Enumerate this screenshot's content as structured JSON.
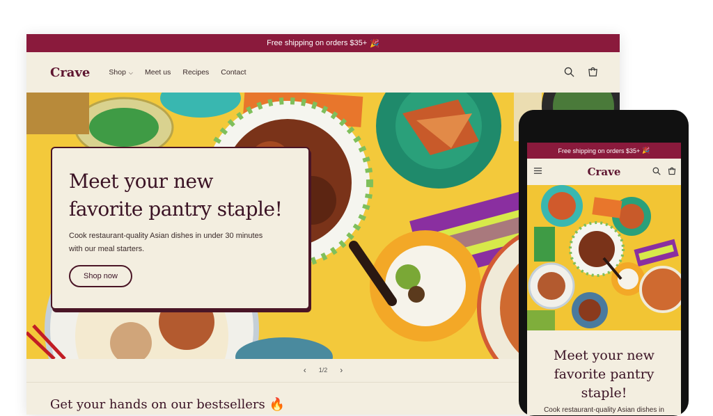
{
  "announcement": {
    "text": "Free shipping on orders $35+",
    "emoji": "🎉"
  },
  "brand": {
    "name": "Crave",
    "color": "#5e1530",
    "accent": "#8a1a3c"
  },
  "nav": {
    "items": [
      {
        "label": "Shop",
        "has_dropdown": true
      },
      {
        "label": "Meet us"
      },
      {
        "label": "Recipes"
      },
      {
        "label": "Contact"
      }
    ]
  },
  "header_icons": [
    "search-icon",
    "cart-icon"
  ],
  "hero": {
    "title_line1": "Meet your new",
    "title_line2": "favorite pantry staple!",
    "subtitle_line1": "Cook restaurant-quality Asian dishes in under 30 minutes",
    "subtitle_line2": "with our meal starters.",
    "button": "Shop now"
  },
  "slider": {
    "counter": "1/2"
  },
  "section": {
    "title": "Get your hands on our bestsellers",
    "emoji": "🔥"
  },
  "mobile": {
    "announcement": "Free shipping on orders $35+",
    "title_line1": "Meet your new",
    "title_line2": "favorite pantry",
    "title_line3": "staple!",
    "subtitle": "Cook restaurant-quality Asian dishes in"
  }
}
